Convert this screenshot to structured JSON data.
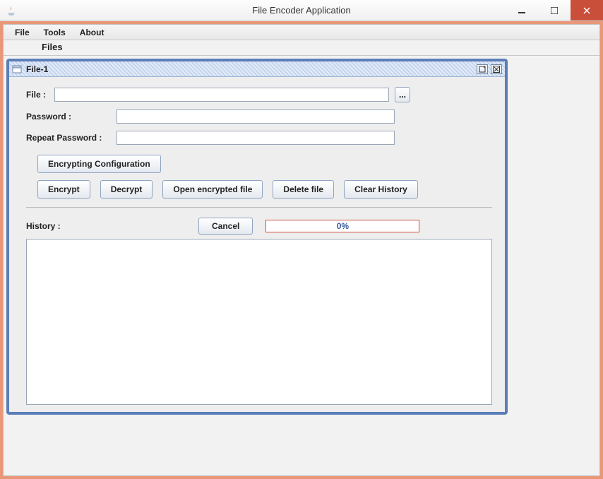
{
  "window": {
    "title": "File Encoder Application"
  },
  "menubar": {
    "items": [
      "File",
      "Tools",
      "About"
    ]
  },
  "section": {
    "title": "Files"
  },
  "internal_frame": {
    "title": "File-1"
  },
  "form": {
    "file_label": "File :",
    "file_value": "",
    "browse_label": "...",
    "password_label": "Password :",
    "password_value": "",
    "repeat_password_label": "Repeat Password :",
    "repeat_password_value": ""
  },
  "buttons": {
    "encrypting_configuration": "Encrypting Configuration",
    "encrypt": "Encrypt",
    "decrypt": "Decrypt",
    "open_encrypted_file": "Open encrypted file",
    "delete_file": "Delete file",
    "clear_history": "Clear History",
    "cancel": "Cancel"
  },
  "history": {
    "label": "History :"
  },
  "progress": {
    "text": "0%"
  }
}
